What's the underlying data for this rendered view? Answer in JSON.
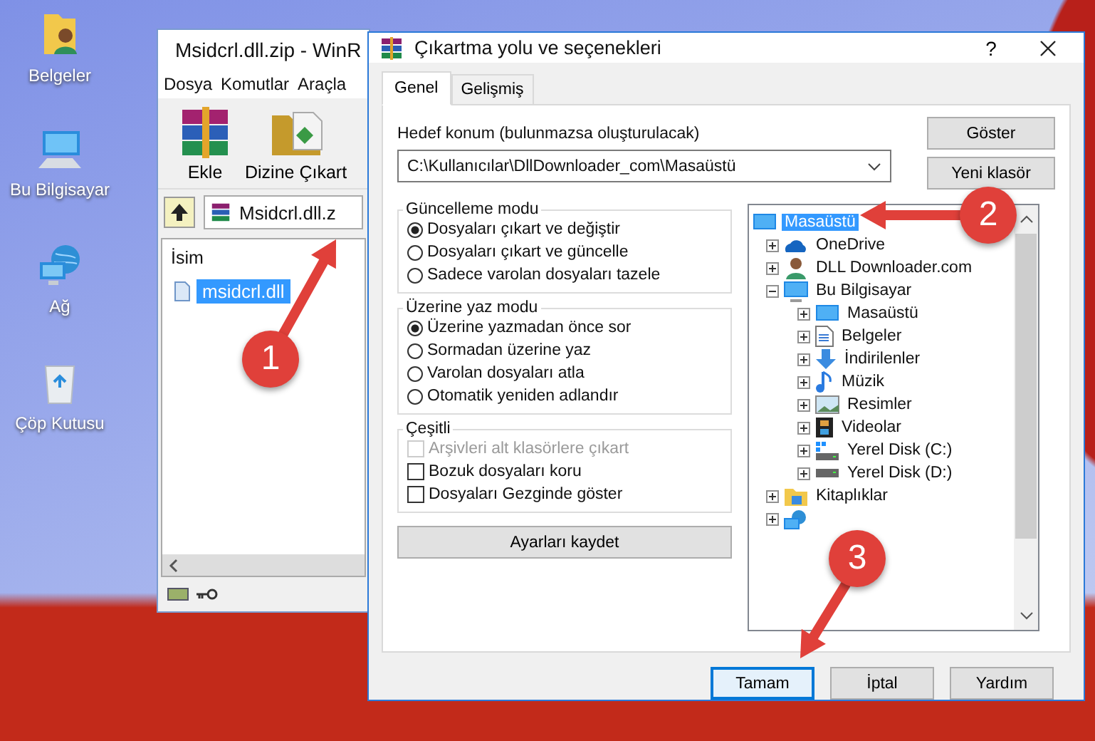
{
  "desktop_icons": [
    {
      "label": "Belgeler",
      "kind": "user-folder"
    },
    {
      "label": "Bu Bilgisayar",
      "kind": "computer"
    },
    {
      "label": "Ağ",
      "kind": "network"
    },
    {
      "label": "Çöp Kutusu",
      "kind": "recycle-bin"
    }
  ],
  "archive_window": {
    "title": "Msidcrl.dll.zip - WinR",
    "menu": [
      "Dosya",
      "Komutlar",
      "Araçla"
    ],
    "toolbar": [
      {
        "label": "Ekle",
        "kind": "add"
      },
      {
        "label": "Dizine Çıkart",
        "kind": "extract"
      }
    ],
    "address": "Msidcrl.dll.z",
    "column": "İsim",
    "files": [
      {
        "name": "msidcrl.dll",
        "selected": true
      }
    ]
  },
  "dialog": {
    "title": "Çıkartma yolu ve seçenekleri",
    "help": "?",
    "tabs": [
      {
        "label": "Genel",
        "selected": true
      },
      {
        "label": "Gelişmiş",
        "selected": false
      }
    ],
    "destination_label": "Hedef konum (bulunmazsa oluşturulacak)",
    "destination_value": "C:\\Kullanıcılar\\DllDownloader_com\\Masaüstü",
    "side_buttons": [
      "Göster",
      "Yeni klasör"
    ],
    "groups": [
      {
        "title": "Güncelleme modu",
        "kind": "radio",
        "options": [
          {
            "label": "Dosyaları çıkart ve değiştir",
            "selected": true
          },
          {
            "label": "Dosyaları çıkart ve güncelle",
            "selected": false
          },
          {
            "label": "Sadece varolan dosyaları tazele",
            "selected": false
          }
        ]
      },
      {
        "title": "Üzerine yaz modu",
        "kind": "radio",
        "options": [
          {
            "label": "Üzerine yazmadan önce sor",
            "selected": true
          },
          {
            "label": "Sormadan üzerine yaz",
            "selected": false
          },
          {
            "label": "Varolan dosyaları atla",
            "selected": false
          },
          {
            "label": "Otomatik yeniden adlandır",
            "selected": false
          }
        ]
      },
      {
        "title": "Çeşitli",
        "kind": "checkbox",
        "options": [
          {
            "label": "Arşivleri alt klasörlere çıkart",
            "checked": false,
            "disabled": true
          },
          {
            "label": "Bozuk dosyaları koru",
            "checked": false,
            "disabled": false
          },
          {
            "label": "Dosyaları Gezginde göster",
            "checked": false,
            "disabled": false
          }
        ]
      }
    ],
    "save_button": "Ayarları kaydet",
    "tree": [
      {
        "label": "Masaüstü",
        "kind": "desktop",
        "selected": true,
        "children": [
          {
            "label": "OneDrive",
            "kind": "cloud",
            "selected": false,
            "expanded": false
          },
          {
            "label": "DLL Downloader.com",
            "kind": "user",
            "selected": false,
            "expanded": false
          },
          {
            "label": "Bu Bilgisayar",
            "kind": "computer",
            "selected": false,
            "expanded": true,
            "children": [
              {
                "label": "Masaüstü",
                "kind": "desktop",
                "selected": false,
                "expanded": false
              },
              {
                "label": "Belgeler",
                "kind": "document",
                "selected": false,
                "expanded": false
              },
              {
                "label": "İndirilenler",
                "kind": "download",
                "selected": false,
                "expanded": false
              },
              {
                "label": "Müzik",
                "kind": "music",
                "selected": false,
                "expanded": false
              },
              {
                "label": "Resimler",
                "kind": "picture",
                "selected": false,
                "expanded": false
              },
              {
                "label": "Videolar",
                "kind": "video",
                "selected": false,
                "expanded": false
              },
              {
                "label": "Yerel Disk (C:)",
                "kind": "system-drive",
                "selected": false,
                "expanded": false
              },
              {
                "label": "Yerel Disk (D:)",
                "kind": "drive",
                "selected": false,
                "expanded": false
              }
            ]
          },
          {
            "label": "Kitaplıklar",
            "kind": "library",
            "selected": false,
            "expanded": false
          },
          {
            "kind": "network",
            "selected": false,
            "expanded": false
          }
        ]
      }
    ],
    "footer_buttons": [
      {
        "label": "Tamam",
        "default": true
      },
      {
        "label": "İptal",
        "default": false
      },
      {
        "label": "Yardım",
        "default": false
      }
    ]
  },
  "annotations": [
    {
      "number": "1"
    },
    {
      "number": "2"
    },
    {
      "number": "3"
    }
  ]
}
